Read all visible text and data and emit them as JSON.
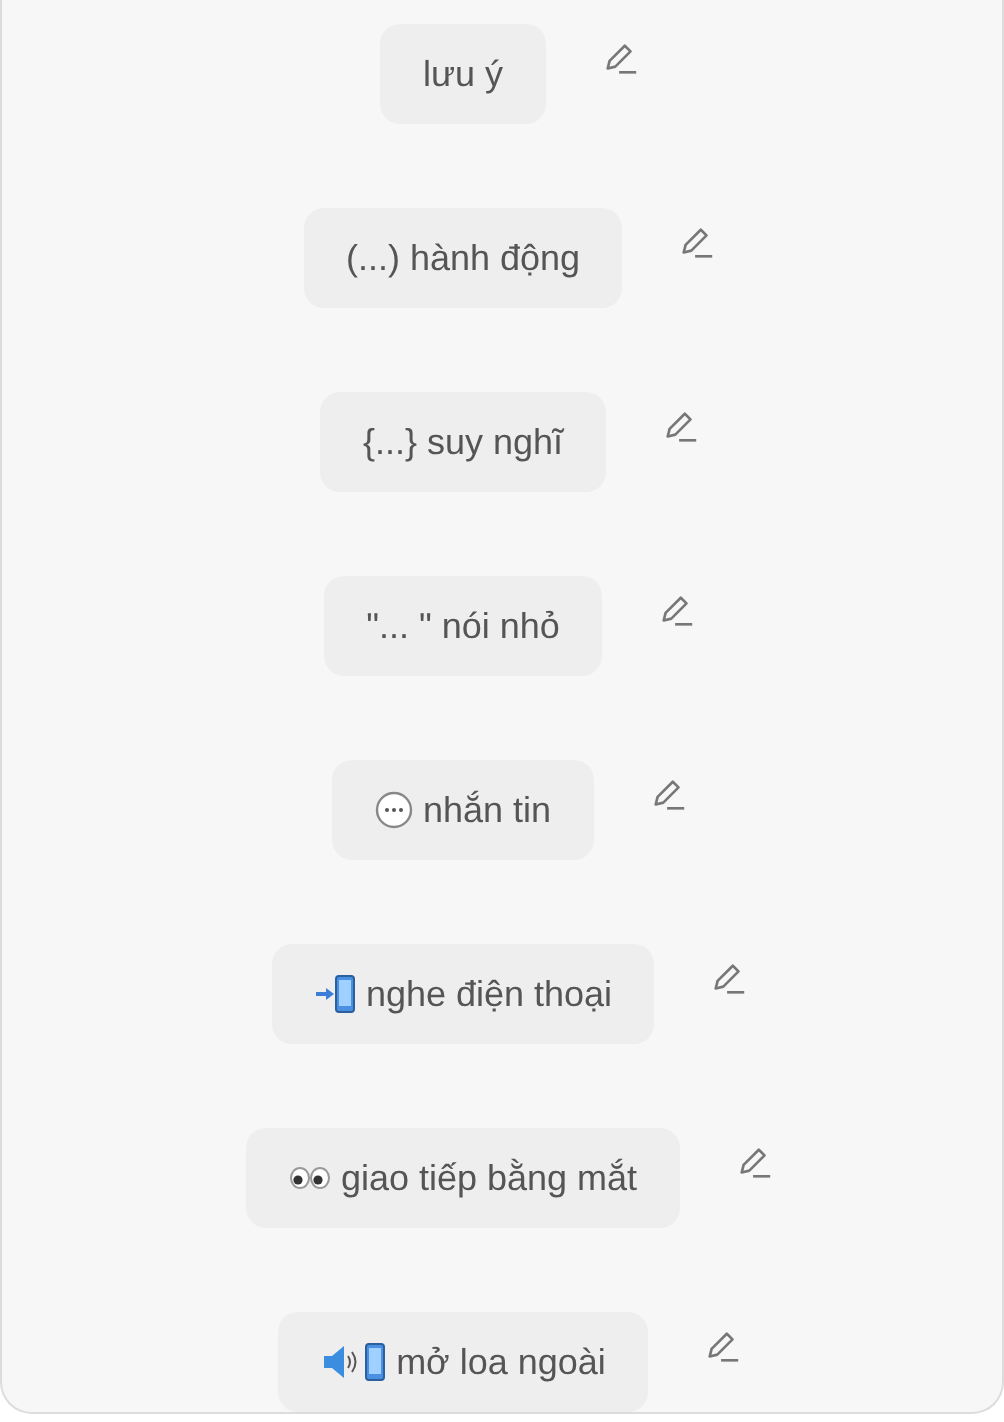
{
  "items": [
    {
      "kind": "text",
      "label": "lưu ý"
    },
    {
      "kind": "text",
      "label": "(...) hành động"
    },
    {
      "kind": "text",
      "label": "{...} suy nghĩ"
    },
    {
      "kind": "text",
      "label": "\"... \" nói nhỏ"
    },
    {
      "kind": "chat",
      "label": "nhắn tin"
    },
    {
      "kind": "phone",
      "label": "nghe điện thoại"
    },
    {
      "kind": "eyes",
      "label": "giao tiếp bằng mắt"
    },
    {
      "kind": "speaker",
      "label": "mở loa ngoài"
    }
  ]
}
